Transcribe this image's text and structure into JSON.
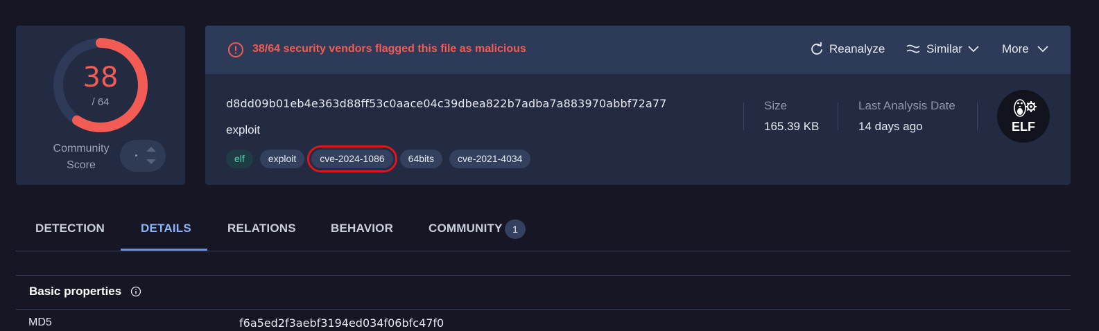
{
  "score": {
    "detected": "38",
    "total": "/ 64",
    "detected_fraction": 0.59375,
    "ring_color": "#f25c54",
    "community_label": "Community Score"
  },
  "alert": {
    "icon": "alert-circle-icon",
    "text": "38/64 security vendors flagged this file as malicious",
    "color": "#f25c54"
  },
  "actions": {
    "reanalyze": "Reanalyze",
    "similar": "Similar",
    "more": "More"
  },
  "file": {
    "hash": "d8dd09b01eb4e363d88ff53c0aace04c39dbea822b7adba7a883970abbf72a77",
    "type": "exploit",
    "tags": [
      "elf",
      "exploit",
      "cve-2024-1086",
      "64bits",
      "cve-2021-4034"
    ],
    "highlighted_tag": "cve-2024-1086"
  },
  "meta": {
    "size_label": "Size",
    "size_value": "165.39 KB",
    "date_label": "Last Analysis Date",
    "date_value": "14 days ago",
    "badge": "ELF"
  },
  "tabs": {
    "detection": "DETECTION",
    "details": "DETAILS",
    "relations": "RELATIONS",
    "behavior": "BEHAVIOR",
    "community": "COMMUNITY",
    "community_count": "1",
    "active": "DETAILS"
  },
  "basic_properties": {
    "title": "Basic properties",
    "md5_label": "MD5",
    "md5_value": "f6a5ed2f3aebf3194ed034f06bfc47f0"
  }
}
